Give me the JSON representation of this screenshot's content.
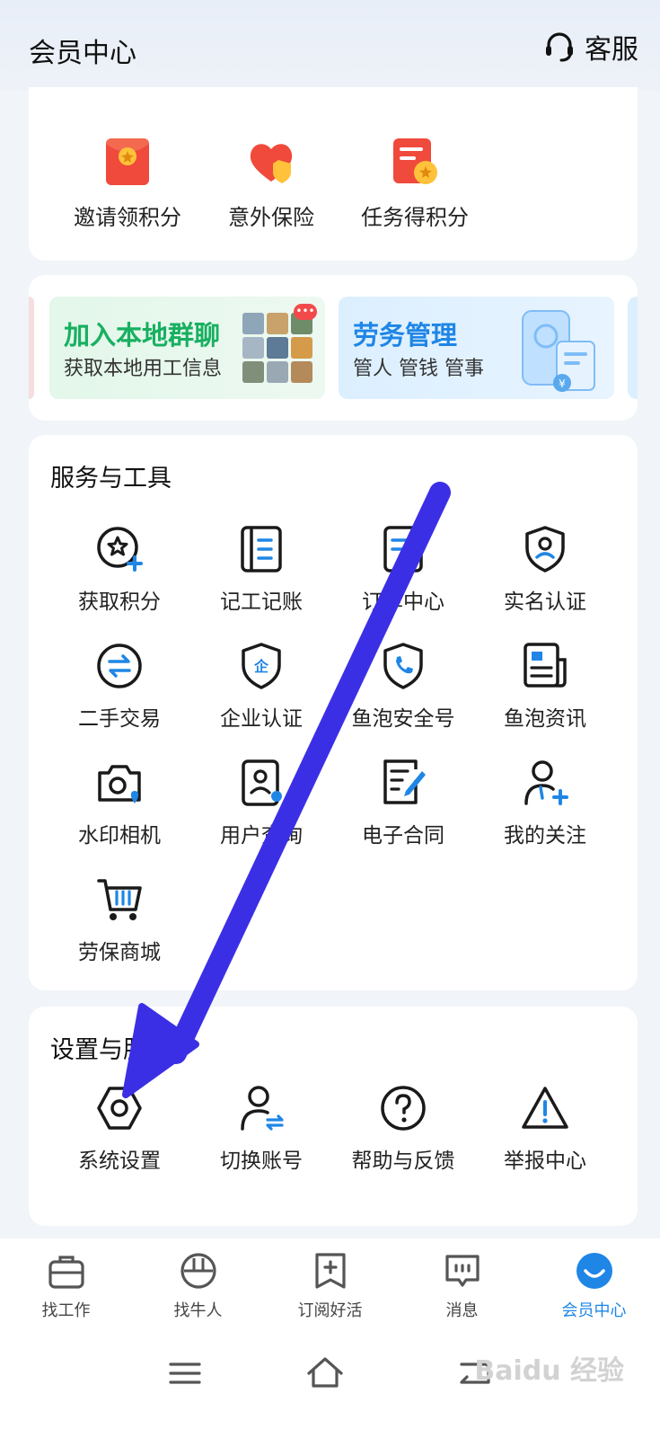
{
  "header": {
    "title": "会员中心",
    "service_label": "客服"
  },
  "top_items": [
    {
      "label": "邀请领积分",
      "icon": "red-envelope-icon"
    },
    {
      "label": "意外保险",
      "icon": "heart-shield-icon"
    },
    {
      "label": "任务得积分",
      "icon": "task-points-icon"
    }
  ],
  "banners": {
    "group": {
      "title": "加入本地群聊",
      "subtitle": "获取本地用工信息",
      "badge": "•••"
    },
    "labor": {
      "title": "劳务管理",
      "subtitle": "管人 管钱 管事"
    }
  },
  "services": {
    "title": "服务与工具",
    "items": [
      {
        "label": "获取积分",
        "icon": "star-plus-icon"
      },
      {
        "label": "记工记账",
        "icon": "notebook-icon"
      },
      {
        "label": "订单中心",
        "icon": "order-icon"
      },
      {
        "label": "实名认证",
        "icon": "id-shield-icon"
      },
      {
        "label": "二手交易",
        "icon": "exchange-icon"
      },
      {
        "label": "企业认证",
        "icon": "enterprise-shield-icon"
      },
      {
        "label": "鱼泡安全号",
        "icon": "phone-shield-icon"
      },
      {
        "label": "鱼泡资讯",
        "icon": "news-icon"
      },
      {
        "label": "水印相机",
        "icon": "camera-icon"
      },
      {
        "label": "用户查询",
        "icon": "user-card-icon"
      },
      {
        "label": "电子合同",
        "icon": "contract-icon"
      },
      {
        "label": "我的关注",
        "icon": "user-follow-icon"
      },
      {
        "label": "劳保商城",
        "icon": "cart-icon"
      }
    ]
  },
  "settings": {
    "title": "设置与服务",
    "items": [
      {
        "label": "系统设置",
        "icon": "gear-icon"
      },
      {
        "label": "切换账号",
        "icon": "switch-account-icon"
      },
      {
        "label": "帮助与反馈",
        "icon": "help-icon"
      },
      {
        "label": "举报中心",
        "icon": "warning-icon"
      }
    ]
  },
  "tabbar": {
    "items": [
      {
        "label": "找工作",
        "icon": "briefcase-icon"
      },
      {
        "label": "找牛人",
        "icon": "helmet-icon"
      },
      {
        "label": "订阅好活",
        "icon": "bookmark-plus-icon"
      },
      {
        "label": "消息",
        "icon": "message-icon"
      },
      {
        "label": "会员中心",
        "icon": "smile-icon",
        "active": true
      }
    ]
  },
  "watermark": "Baidu 经验",
  "colors": {
    "accent": "#1f86e6",
    "arrow": "#3b2fe6",
    "icon": "#1a1a1a",
    "icon_accent": "#1f86e6"
  }
}
